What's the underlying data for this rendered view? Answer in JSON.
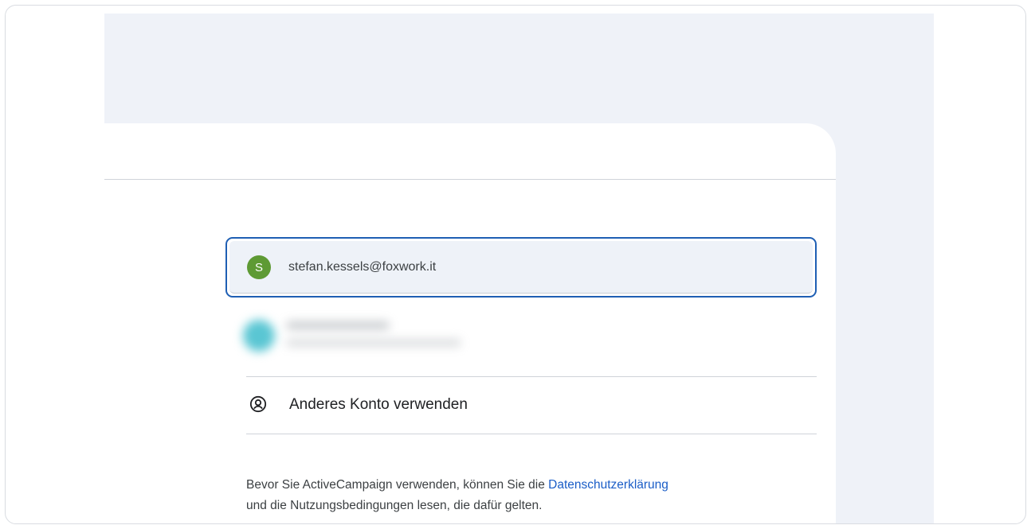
{
  "account_chooser": {
    "selected_account": {
      "avatar_initial": "S",
      "email": "stefan.kessels@foxwork.it",
      "avatar_color": "#5e9a34"
    },
    "other_account_label": "Anderes Konto verwenden",
    "notice": {
      "text_before": "Bevor Sie ActiveCampaign verwenden, können Sie die ",
      "privacy_link": "Datenschutzerklärung",
      "text_after": "und die Nutzungsbedingungen lesen, die dafür gelten."
    }
  },
  "colors": {
    "highlight_border": "#1f5fb4",
    "link": "#1a5dc7",
    "background": "#eff2f8"
  }
}
